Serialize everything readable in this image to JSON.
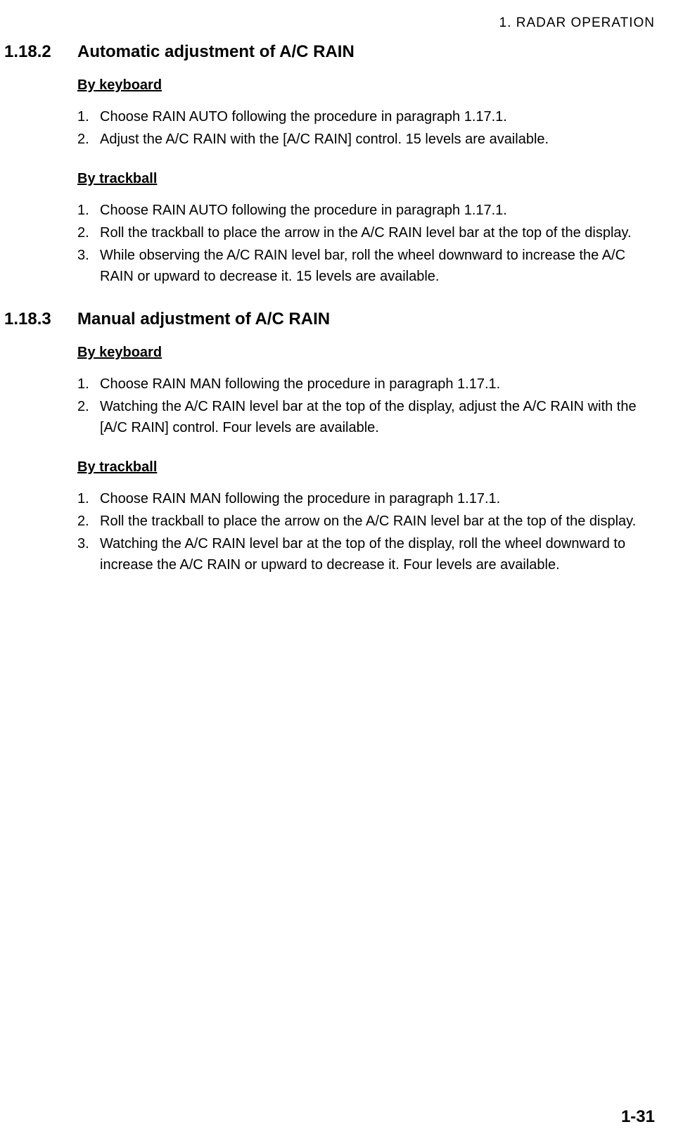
{
  "header": {
    "chapter_label": "1.  RADAR  OPERATION"
  },
  "sections": {
    "s1": {
      "number": "1.18.2",
      "title": "Automatic adjustment of A/C RAIN",
      "sub1": {
        "title": "By keyboard",
        "item1_num": "1.",
        "item1_text": "Choose RAIN AUTO following the procedure in paragraph 1.17.1.",
        "item2_num": "2.",
        "item2_text": "Adjust the A/C RAIN with the [A/C RAIN] control. 15 levels are available."
      },
      "sub2": {
        "title": "By trackball",
        "item1_num": "1.",
        "item1_text": "Choose RAIN AUTO following the procedure in paragraph 1.17.1.",
        "item2_num": "2.",
        "item2_text": "Roll the trackball to place the arrow in the A/C RAIN level bar at the top of the display.",
        "item3_num": "3.",
        "item3_text": "While observing the A/C RAIN level bar, roll the wheel downward to increase the A/C RAIN or upward to decrease it. 15 levels are available."
      }
    },
    "s2": {
      "number": "1.18.3",
      "title": "Manual adjustment of A/C RAIN",
      "sub1": {
        "title": "By keyboard",
        "item1_num": "1.",
        "item1_text": "Choose RAIN MAN following the procedure in paragraph 1.17.1.",
        "item2_num": "2.",
        "item2_text": " Watching the A/C RAIN level bar at the top of the display, adjust the A/C RAIN with the [A/C RAIN] control. Four levels are available."
      },
      "sub2": {
        "title": "By trackball",
        "item1_num": "1.",
        "item1_text": "Choose RAIN MAN following the procedure in paragraph 1.17.1.",
        "item2_num": "2.",
        "item2_text": "Roll the trackball to place the arrow on the A/C RAIN level bar at the top of the display.",
        "item3_num": "3.",
        "item3_text": "Watching the A/C RAIN level bar at the top of the display, roll the wheel downward to increase the A/C RAIN or upward to decrease it. Four levels are available."
      }
    }
  },
  "footer": {
    "page_number": "1-31"
  }
}
